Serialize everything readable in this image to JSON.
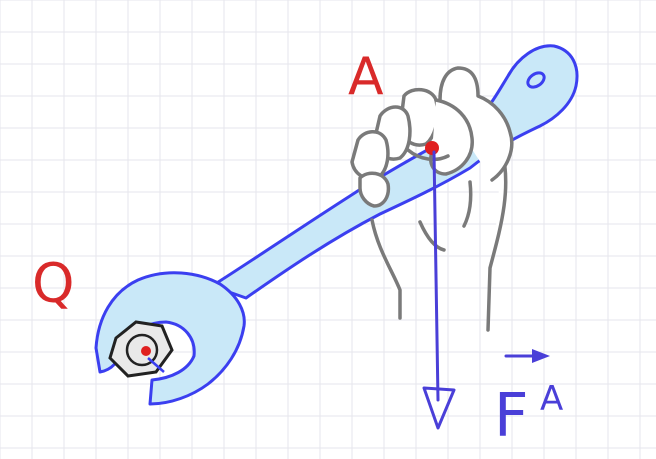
{
  "diagram": {
    "labels": {
      "point_a": "A",
      "point_q": "Q",
      "force_symbol": "F",
      "force_subscript": "A"
    },
    "colors": {
      "grid_line": "#e6e6ec",
      "wrench_outline": "#3b3ff0",
      "wrench_fill": "#c9e8f8",
      "hand_outline": "#7a7a7a",
      "hand_fill": "#ffffff",
      "point_marker": "#e02020",
      "label_red": "#d92a2a",
      "force_vector": "#4a3fd8",
      "nut_outline": "#222222",
      "nut_fill": "#e9e9e9"
    },
    "icons": {
      "wrench": "wrench-icon",
      "hand": "hand-icon",
      "nut": "hex-nut-icon",
      "force": "force-arrow-icon"
    }
  }
}
